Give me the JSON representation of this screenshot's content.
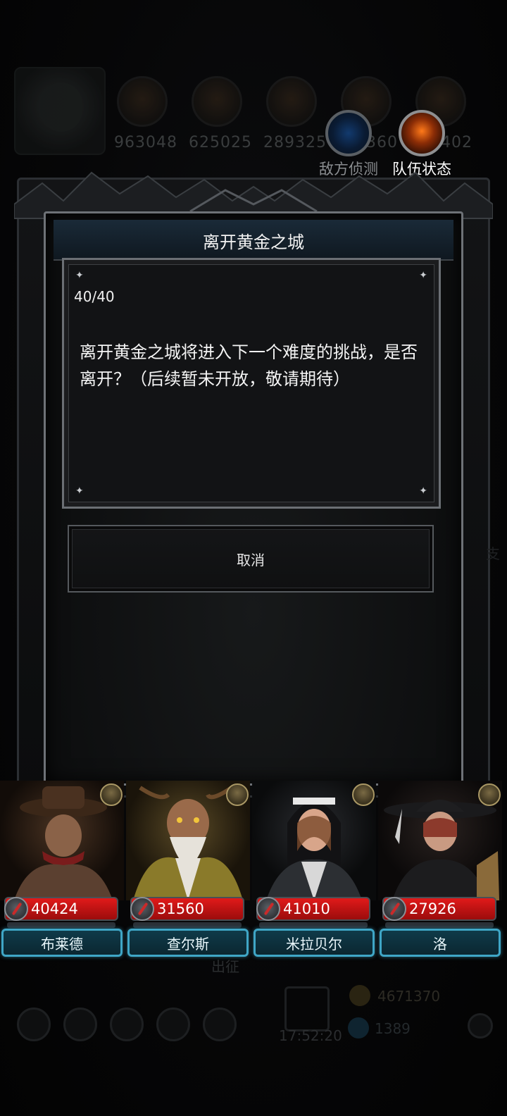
{
  "hud": {
    "stats": [
      "963048",
      "625025",
      "289325",
      "360",
      "402"
    ],
    "enemy_scout_label": "敌方侦测",
    "team_status_label": "队伍状态"
  },
  "dialog": {
    "title": "离开黄金之城",
    "count": "40/40",
    "message": "离开黄金之城将进入下一个难度的挑战，是否离开？（后续暂未开放，敬请期待）",
    "cancel_label": "取消"
  },
  "side_hint": "支",
  "heroes": [
    {
      "name": "布莱德",
      "hp": "40424"
    },
    {
      "name": "查尔斯",
      "hp": "31560"
    },
    {
      "name": "米拉贝尔",
      "hp": "41010"
    },
    {
      "name": "洛",
      "hp": "27926"
    }
  ],
  "bottom": {
    "depart_label": "出征",
    "timer": "17:52:20",
    "gold": "4671370",
    "gems": "1389"
  }
}
